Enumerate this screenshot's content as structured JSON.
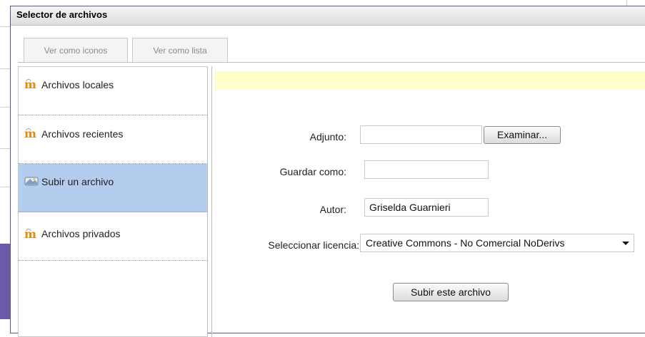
{
  "dialog": {
    "title": "Selector de archivos"
  },
  "view_tabs": {
    "icons_label": "Ver como iconos",
    "list_label": "Ver como lista"
  },
  "sidebar": {
    "items": [
      {
        "label": "Archivos locales",
        "icon": "moodle-icon",
        "active": false
      },
      {
        "label": "Archivos recientes",
        "icon": "moodle-icon",
        "active": false
      },
      {
        "label": "Subir un archivo",
        "icon": "upload-icon",
        "active": true
      },
      {
        "label": "Archivos privados",
        "icon": "moodle-icon",
        "active": false
      }
    ]
  },
  "form": {
    "attachment_label": "Adjunto:",
    "attachment_value": "",
    "browse_label": "Examinar...",
    "save_as_label": "Guardar como:",
    "save_as_value": "",
    "author_label": "Autor:",
    "author_value": "Griselda Guarnieri",
    "license_label": "Seleccionar licencia:",
    "license_value": "Creative Commons - No Comercial NoDerivs",
    "submit_label": "Subir este archivo"
  },
  "colors": {
    "accent": "#6b4f95",
    "selected": "#b4cdef",
    "notice": "#ffffcc",
    "moodle_orange": "#e38a0d"
  }
}
